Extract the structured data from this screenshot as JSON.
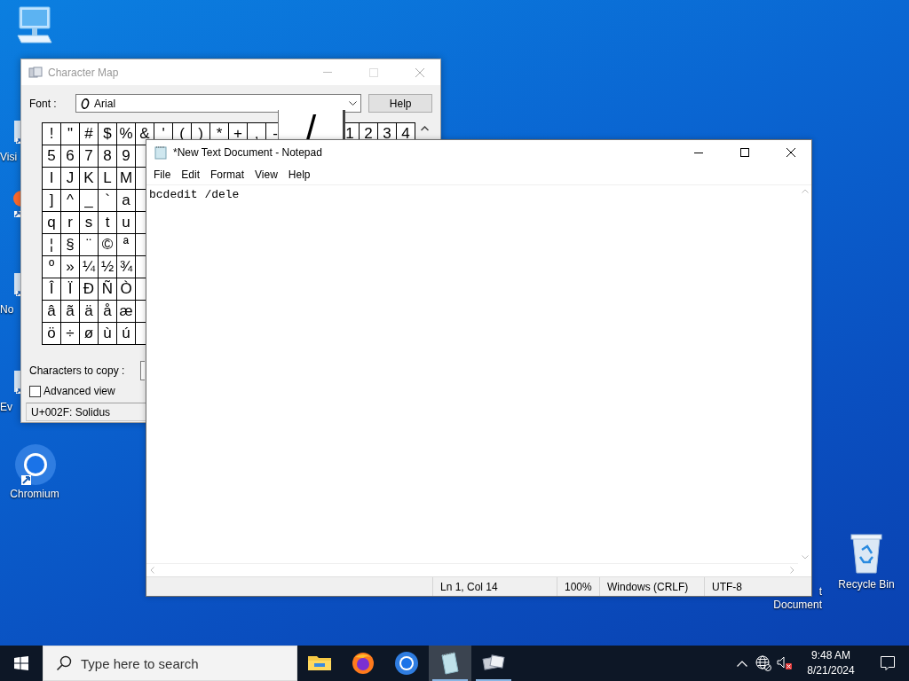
{
  "desktop": {
    "icons": [
      {
        "kind": "computer"
      },
      {
        "kind": "shortcut",
        "label": "Visi"
      },
      {
        "kind": "browser_shortcut"
      },
      {
        "kind": "shortcut",
        "label": "No"
      },
      {
        "kind": "shortcut",
        "label": "Ev"
      },
      {
        "kind": "chromium",
        "label": "Chromium"
      },
      {
        "kind": "document",
        "label": "t Document"
      },
      {
        "kind": "recycle_bin",
        "label": "Recycle Bin"
      }
    ]
  },
  "character_map": {
    "title": "Character Map",
    "font_label": "Font :",
    "font": "Arial",
    "help_button": "Help",
    "grid": {
      "first_row": [
        "!",
        "\"",
        "#",
        "$",
        "%",
        "&",
        "'",
        "(",
        ")",
        "*",
        "+",
        ",",
        "-"
      ],
      "magnified": "/",
      "first_row_tail": [
        "1",
        "2",
        "3",
        "4"
      ],
      "rows": [
        [
          "5",
          "6",
          "7",
          "8",
          "9"
        ],
        [
          "I",
          "J",
          "K",
          "L",
          "M"
        ],
        [
          "]",
          "^",
          "_",
          "`",
          "a"
        ],
        [
          "q",
          "r",
          "s",
          "t",
          "u"
        ],
        [
          "¦",
          "§",
          "¨",
          "©",
          "ª"
        ],
        [
          "º",
          "»",
          "¼",
          "½",
          "¾"
        ],
        [
          "Î",
          "Ï",
          "Ð",
          "Ñ",
          "Ò"
        ],
        [
          "â",
          "ã",
          "ä",
          "å",
          "æ"
        ],
        [
          "ö",
          "÷",
          "ø",
          "ù",
          "ú"
        ]
      ]
    },
    "copy_label": "Characters to copy :",
    "advanced_view": {
      "label": "Advanced view",
      "checked": false
    },
    "status": "U+002F: Solidus"
  },
  "notepad": {
    "title": "*New Text Document - Notepad",
    "menu": [
      "File",
      "Edit",
      "Format",
      "View",
      "Help"
    ],
    "text": "bcdedit /dele",
    "status_bar": [
      "Ln 1, Col 14",
      "100%",
      "Windows (CRLF)",
      "UTF-8"
    ]
  },
  "taskbar": {
    "search": {
      "placeholder": "Type here to search"
    },
    "apps": [
      {
        "kind": "explorer",
        "selected": false,
        "running": false
      },
      {
        "kind": "firefox",
        "selected": false,
        "running": false
      },
      {
        "kind": "chromium",
        "selected": false,
        "running": false
      },
      {
        "kind": "notepad",
        "selected": true,
        "running": true
      },
      {
        "kind": "charmap",
        "selected": false,
        "running": true
      }
    ],
    "time": "9:48 AM",
    "date": "8/21/2024"
  }
}
